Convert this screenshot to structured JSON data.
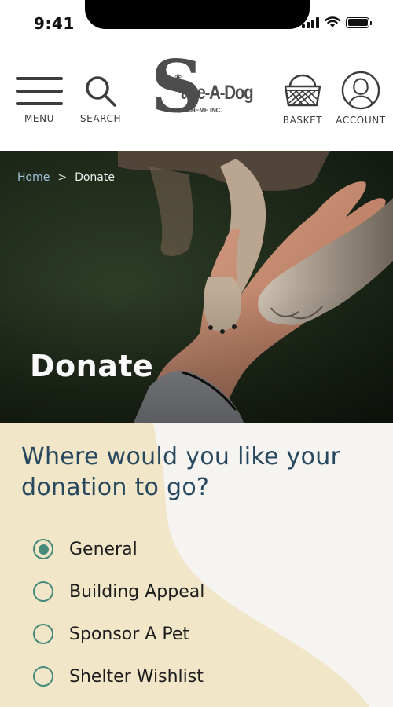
{
  "status_bar": {
    "time": "9:41"
  },
  "header": {
    "menu_label": "MENU",
    "search_label": "SEARCH",
    "basket_label": "BASKET",
    "account_label": "ACCOUNT",
    "logo": {
      "main": "ave-A-Dog",
      "sub": "SCHEME INC."
    }
  },
  "hero": {
    "breadcrumb": {
      "home": "Home",
      "separator": ">",
      "current": "Donate"
    },
    "title": "Donate"
  },
  "donation": {
    "question": "Where would you like your donation to go?",
    "options": [
      {
        "label": "General",
        "selected": true
      },
      {
        "label": "Building Appeal",
        "selected": false
      },
      {
        "label": "Sponsor A Pet",
        "selected": false
      },
      {
        "label": "Shelter Wishlist",
        "selected": false
      }
    ]
  },
  "colors": {
    "heading": "#27485e",
    "radio_accent": "#468a7c",
    "content_background": "#f1e6c8",
    "content_shape": "#f5f4f1",
    "breadcrumb_link": "#9fc3dc"
  }
}
